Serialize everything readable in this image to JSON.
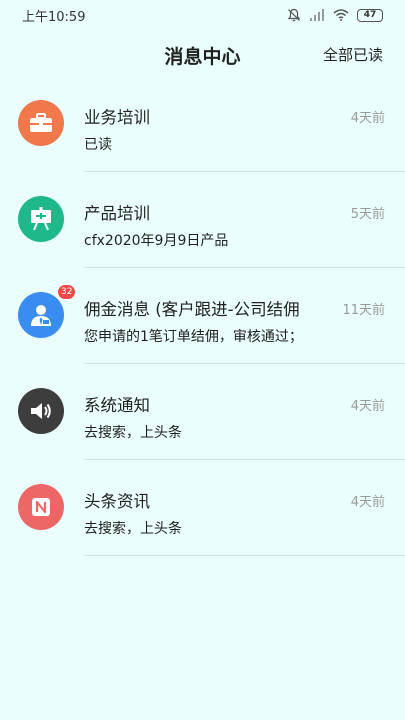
{
  "status_bar": {
    "time": "上午10:59",
    "battery": "47"
  },
  "header": {
    "title": "消息中心",
    "mark_all_label": "全部已读"
  },
  "messages": [
    {
      "title": "业务培训",
      "time": "4天前",
      "preview": "已读",
      "icon": "briefcase-icon",
      "color": "#f0784a",
      "badge": ""
    },
    {
      "title": "产品培训",
      "time": "5天前",
      "preview": "cfx2020年9月9日产品",
      "icon": "presentation-board-icon",
      "color": "#1fb88a",
      "badge": ""
    },
    {
      "title": "佣金消息 (客户跟进-公司结佣",
      "time": "11天前",
      "preview": "您申请的1笔订单结佣，审核通过；",
      "icon": "agent-icon",
      "color": "#3a8df0",
      "badge": "32"
    },
    {
      "title": "系统通知",
      "time": "4天前",
      "preview": "去搜索，上头条",
      "icon": "speaker-icon",
      "color": "#3d3d3d",
      "badge": ""
    },
    {
      "title": "头条资讯",
      "time": "4天前",
      "preview": "去搜索，上头条",
      "icon": "news-icon",
      "color": "#ee6766",
      "badge": ""
    }
  ]
}
